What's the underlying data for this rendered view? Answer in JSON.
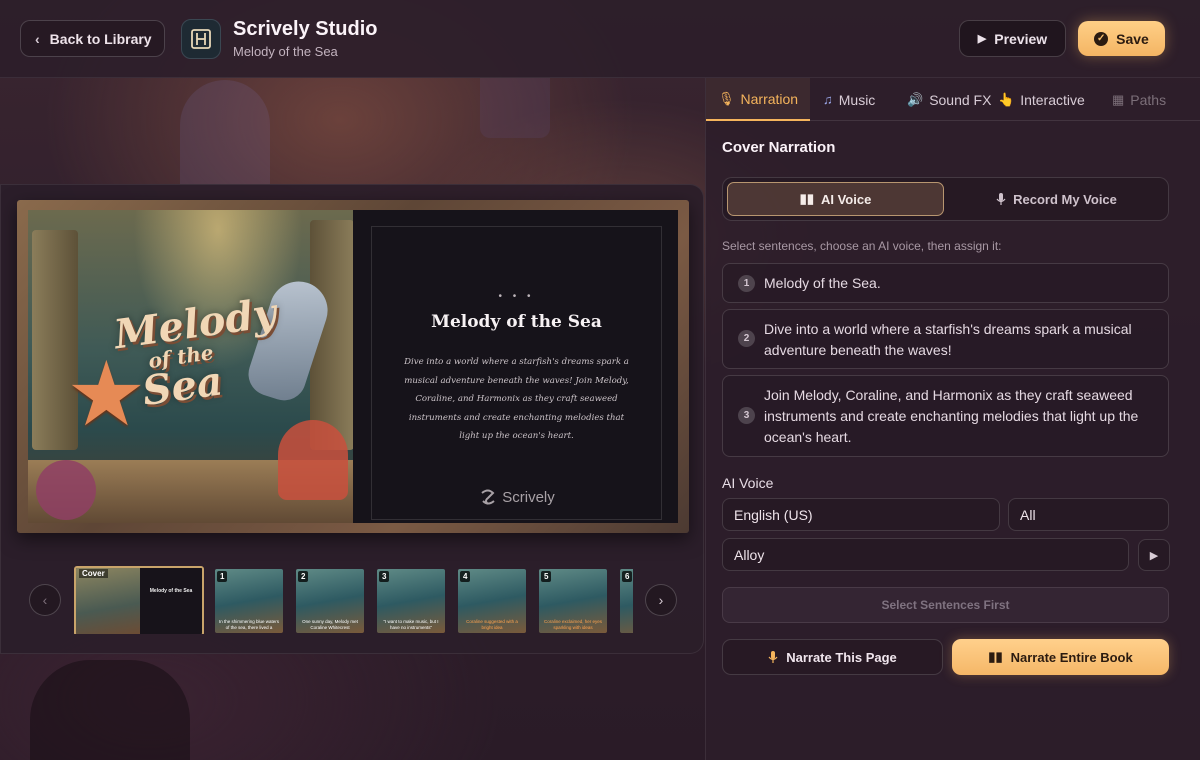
{
  "header": {
    "back_label": "Back to Library",
    "app_title": "Scrively Studio",
    "book_title": "Melody of the Sea",
    "preview_label": "Preview",
    "save_label": "Save"
  },
  "book": {
    "page_title": "Melody of the Sea",
    "page_text": "Dive into a world where a starfish's dreams spark a musical adventure beneath the waves! Join Melody, Coraline, and Harmonix as they craft seaweed instruments and create enchanting melodies that light up the ocean's heart.",
    "cover_art_title_1": "Melody",
    "cover_art_title_2": "of the",
    "cover_art_title_3": "Sea",
    "brand": "Scrively",
    "dots": "• • •"
  },
  "thumbnails": {
    "cover_label": "Cover",
    "cover_title": "Melody of the Sea",
    "pages": [
      {
        "num": "1",
        "caption": "In the shimmering blue waters of the sea, there lived a",
        "accent": false
      },
      {
        "num": "2",
        "caption": "One sunny day, Melody met Coraline Whitecrest",
        "accent": false
      },
      {
        "num": "3",
        "caption": "\"I want to make music, but I have no instruments\"",
        "accent": false
      },
      {
        "num": "4",
        "caption": "Coraline suggested with a bright idea",
        "accent": true
      },
      {
        "num": "5",
        "caption": "Coraline exclaimed, her eyes sparkling with ideas",
        "accent": true
      },
      {
        "num": "6",
        "caption": "",
        "accent": false
      }
    ]
  },
  "panel": {
    "tabs": [
      {
        "label": "Narration",
        "icon": "🎙"
      },
      {
        "label": "Music",
        "icon": "♫"
      },
      {
        "label": "Sound FX",
        "icon": "🔊"
      },
      {
        "label": "Interactive",
        "icon": "👆"
      },
      {
        "label": "Paths",
        "icon": "▦"
      }
    ],
    "section_title": "Cover Narration",
    "ai_voice_label": "AI Voice",
    "record_label": "Record My Voice",
    "hint": "Select sentences, choose an AI voice, then assign it:",
    "sentences": [
      {
        "num": "1",
        "text": "Melody of the Sea."
      },
      {
        "num": "2",
        "text": "Dive into a world where a starfish's dreams spark a musical adventure beneath the waves!"
      },
      {
        "num": "3",
        "text": "Join Melody, Coraline, and Harmonix as they craft seaweed instruments and create enchanting melodies that light up the ocean's heart."
      }
    ],
    "voice_section_label": "AI Voice",
    "language": "English (US)",
    "filter": "All",
    "voice": "Alloy",
    "assign_label": "Select Sentences First",
    "narrate_page_label": "Narrate This Page",
    "narrate_book_label": "Narrate Entire Book"
  },
  "colors": {
    "accent": "#f5b45c",
    "background": "#2f1f2b",
    "panel": "#2c1e2a"
  }
}
